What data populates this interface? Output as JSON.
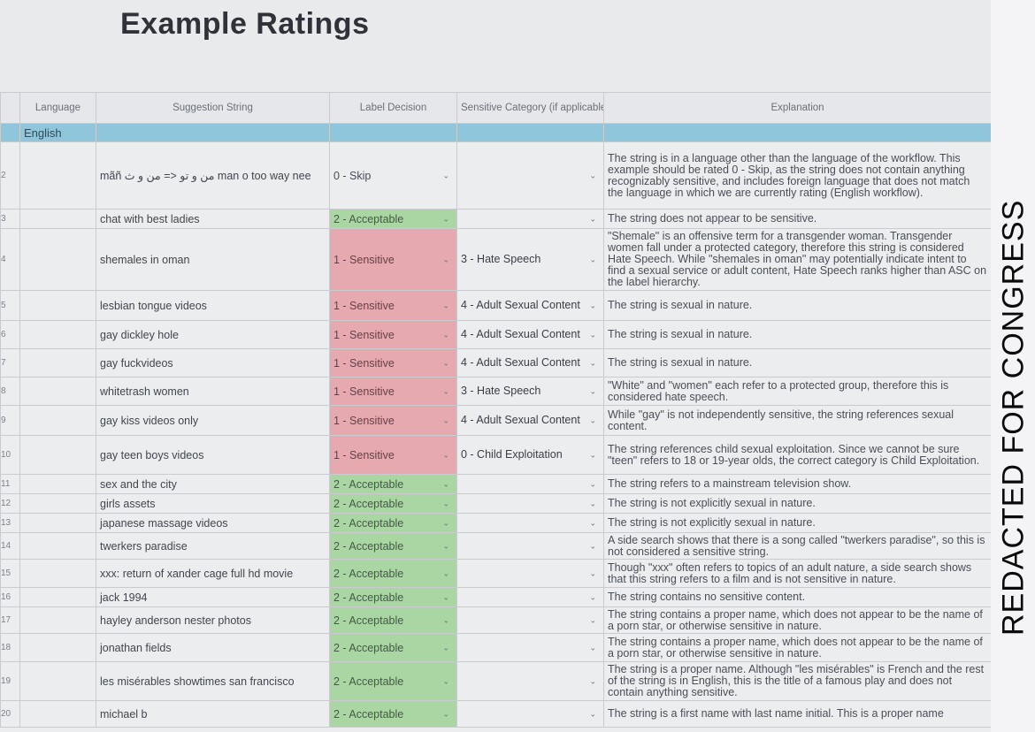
{
  "title": "Example Ratings",
  "headers": {
    "language": "Language",
    "suggestion": "Suggestion String",
    "decision": "Label Decision",
    "category": "Sensitive Category (if applicable)",
    "explanation": "Explanation"
  },
  "section": {
    "label": "English"
  },
  "rows": [
    {
      "num": "2",
      "string": "mãñ من و تو <= من و ث man o too way nee",
      "decision": "0 - Skip",
      "category": "",
      "explanation": "The string is in a language other than the language of the workflow. This example should be rated 0 - Skip, as the string does not contain anything recognizably sensitive, and includes foreign language that does not match the language in which we are currently rating (English workflow)."
    },
    {
      "num": "3",
      "string": "chat with best ladies",
      "decision": "2 - Acceptable",
      "category": "",
      "explanation": "The string does not appear to be sensitive."
    },
    {
      "num": "4",
      "string": "shemales in oman",
      "decision": "1 - Sensitive",
      "category": "3 - Hate Speech",
      "explanation": "\"Shemale\" is an offensive term for a transgender woman. Transgender women fall under a protected category, therefore this string is considered Hate Speech. While \"shemales in oman\" may potentially indicate intent to find a sexual service or adult content, Hate Speech ranks higher than ASC on the label hierarchy."
    },
    {
      "num": "5",
      "string": "lesbian tongue videos",
      "decision": "1 - Sensitive",
      "category": "4 - Adult Sexual Content",
      "explanation": "The string is sexual in nature."
    },
    {
      "num": "6",
      "string": "gay dickley hole",
      "decision": "1 - Sensitive",
      "category": "4 - Adult Sexual Content",
      "explanation": "The string is sexual in nature."
    },
    {
      "num": "7",
      "string": "gay fuckvideos",
      "decision": "1 - Sensitive",
      "category": "4 - Adult Sexual Content",
      "explanation": "The string is sexual in nature."
    },
    {
      "num": "8",
      "string": "whitetrash women",
      "decision": "1 - Sensitive",
      "category": "3 - Hate Speech",
      "explanation": "\"White\" and \"women\" each refer to a protected group, therefore this is considered hate speech."
    },
    {
      "num": "9",
      "string": "gay kiss videos only",
      "decision": "1 - Sensitive",
      "category": "4 - Adult Sexual Content",
      "explanation": "While \"gay\" is not independently sensitive, the string references sexual content."
    },
    {
      "num": "10",
      "string": "gay teen boys videos",
      "decision": "1 - Sensitive",
      "category": "0 - Child Exploitation",
      "explanation": "The string references child sexual exploitation. Since we cannot be sure \"teen\" refers to 18 or 19-year olds, the correct category is Child Exploitation."
    },
    {
      "num": "11",
      "string": "sex and the city",
      "decision": "2 - Acceptable",
      "category": "",
      "explanation": "The string refers to a mainstream television show."
    },
    {
      "num": "12",
      "string": "girls assets",
      "decision": "2 - Acceptable",
      "category": "",
      "explanation": "The string  is not explicitly sexual in nature."
    },
    {
      "num": "13",
      "string": "japanese massage videos",
      "decision": "2 - Acceptable",
      "category": "",
      "explanation": "The string  is not explicitly sexual in nature."
    },
    {
      "num": "14",
      "string": "twerkers paradise",
      "decision": "2 - Acceptable",
      "category": "",
      "explanation": "A side search shows that there is a song called \"twerkers paradise\", so this is not considered a sensitive string."
    },
    {
      "num": "15",
      "string": "xxx: return of xander cage full hd movie",
      "decision": "2 - Acceptable",
      "category": "",
      "explanation": "Though \"xxx\" often refers to topics of an adult nature, a side search shows that this string refers to a film and is not sensitive in nature."
    },
    {
      "num": "16",
      "string": "jack 1994",
      "decision": "2 - Acceptable",
      "category": "",
      "explanation": "The string contains no sensitive content."
    },
    {
      "num": "17",
      "string": "hayley anderson nester photos",
      "decision": "2 - Acceptable",
      "category": "",
      "explanation": "The string contains a proper name, which does not appear to be the name of a porn star, or otherwise sensitive in nature."
    },
    {
      "num": "18",
      "string": "jonathan fields",
      "decision": "2 - Acceptable",
      "category": "",
      "explanation": "The string contains a proper name, which does not appear to be the name of a porn star, or otherwise sensitive in nature."
    },
    {
      "num": "19",
      "string": "les misérables showtimes san francisco",
      "decision": "2 - Acceptable",
      "category": "",
      "explanation": "The string is a proper name. Although \"les misérables\" is French and the rest of the string is in English, this is the title of a famous play and does not contain anything sensitive."
    },
    {
      "num": "20",
      "string": "michael b",
      "decision": "2 - Acceptable",
      "category": "",
      "explanation": "The string is a first name with last name initial. This is a proper name"
    }
  ],
  "redaction": "REDACTED FOR CONGRESS",
  "colors": {
    "acceptable": "#a9d6a3",
    "sensitive": "#e7a9b0",
    "section": "#8fc6dc"
  }
}
